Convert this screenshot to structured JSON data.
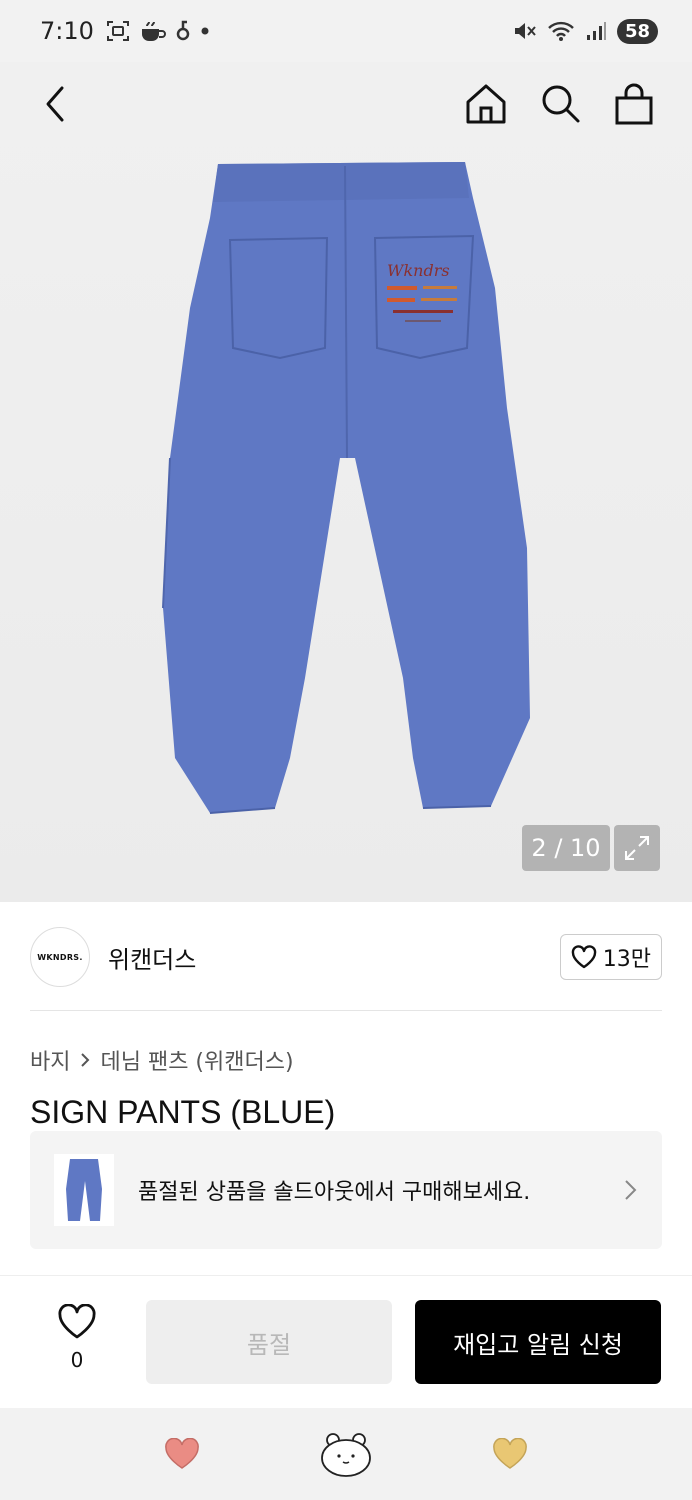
{
  "status_bar": {
    "time": "7:10",
    "battery": "58",
    "left_icons": [
      "screenshot-icon",
      "cup-icon",
      "app-icon",
      "dot-icon"
    ],
    "right_icons": [
      "mute-icon",
      "wifi-icon",
      "signal-icon"
    ]
  },
  "nav": {
    "icons": [
      "back-icon",
      "home-icon",
      "search-icon",
      "shopping-bag-icon"
    ]
  },
  "gallery": {
    "indicator": "2 / 10"
  },
  "brand": {
    "logo_text": "WKNDRS.",
    "name": "위캔더스",
    "likes": "13만"
  },
  "breadcrumb": {
    "category": "바지",
    "subcategory": "데님 팬츠 (위캔더스)"
  },
  "product": {
    "title": "SIGN PANTS (BLUE)"
  },
  "soldout_banner": {
    "text": "품절된 상품을 솔드아웃에서 구매해보세요."
  },
  "actions": {
    "wish_count": "0",
    "soldout_label": "품절",
    "restock_label": "재입고 알림 신청"
  },
  "colors": {
    "denim": "#5f78c4",
    "heart_pink": "#ea8c84",
    "heart_yellow": "#e9c773",
    "primary_button": "#000000"
  }
}
